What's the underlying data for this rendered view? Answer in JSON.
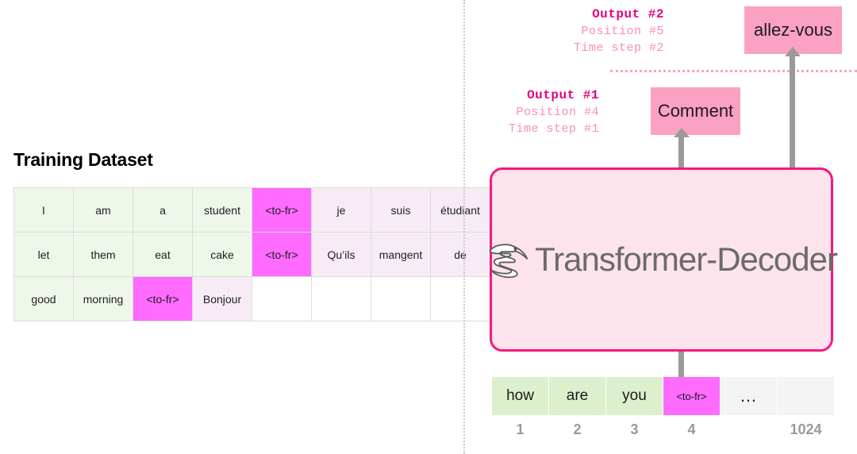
{
  "left": {
    "title": "Training Dataset",
    "table": {
      "rows": [
        [
          {
            "text": "I",
            "kind": "src"
          },
          {
            "text": "am",
            "kind": "src"
          },
          {
            "text": "a",
            "kind": "src"
          },
          {
            "text": "student",
            "kind": "src"
          },
          {
            "text": "<to-fr>",
            "kind": "tok"
          },
          {
            "text": "je",
            "kind": "tgt"
          },
          {
            "text": "suis",
            "kind": "tgt"
          },
          {
            "text": "étudiant",
            "kind": "tgt"
          }
        ],
        [
          {
            "text": "let",
            "kind": "src"
          },
          {
            "text": "them",
            "kind": "src"
          },
          {
            "text": "eat",
            "kind": "src"
          },
          {
            "text": "cake",
            "kind": "src"
          },
          {
            "text": "<to-fr>",
            "kind": "tok"
          },
          {
            "text": "Qu’ils",
            "kind": "tgt"
          },
          {
            "text": "mangent",
            "kind": "tgt"
          },
          {
            "text": "de",
            "kind": "tgt"
          }
        ],
        [
          {
            "text": "good",
            "kind": "src"
          },
          {
            "text": "morning",
            "kind": "src"
          },
          {
            "text": "<to-fr>",
            "kind": "tok"
          },
          {
            "text": "Bonjour",
            "kind": "tgt"
          },
          {
            "text": "",
            "kind": "empty"
          },
          {
            "text": "",
            "kind": "empty"
          },
          {
            "text": "",
            "kind": "empty"
          },
          {
            "text": "",
            "kind": "empty"
          }
        ]
      ]
    }
  },
  "right": {
    "outputs": [
      {
        "id": "output-2",
        "title": "Output #2",
        "position": "Position #5",
        "time_step": "Time step #2",
        "token": "allez-vous"
      },
      {
        "id": "output-1",
        "title": "Output #1",
        "position": "Position #4",
        "time_step": "Time step #1",
        "token": "Comment"
      }
    ],
    "decoder": {
      "label": "Transformer-Decoder",
      "logo_name": "bird-swoosh-logo"
    },
    "input_sequence": {
      "cells": [
        {
          "text": "how",
          "kind": "src"
        },
        {
          "text": "are",
          "kind": "src"
        },
        {
          "text": "you",
          "kind": "src"
        },
        {
          "text": "<to-fr>",
          "kind": "tok"
        },
        {
          "text": "…",
          "kind": "dots"
        },
        {
          "text": "",
          "kind": "blank"
        }
      ],
      "positions": [
        "1",
        "2",
        "3",
        "4",
        "",
        "1024"
      ]
    }
  },
  "colors": {
    "magenta_token": "#ff6aff",
    "source_green": "#dcf0cd",
    "target_lilac": "#f7ecf5",
    "accent_pink": "#f5197e",
    "soft_pink": "#fba1c2",
    "decoder_fill": "#fde3ec",
    "arrow_gray": "#9a9a9a"
  }
}
